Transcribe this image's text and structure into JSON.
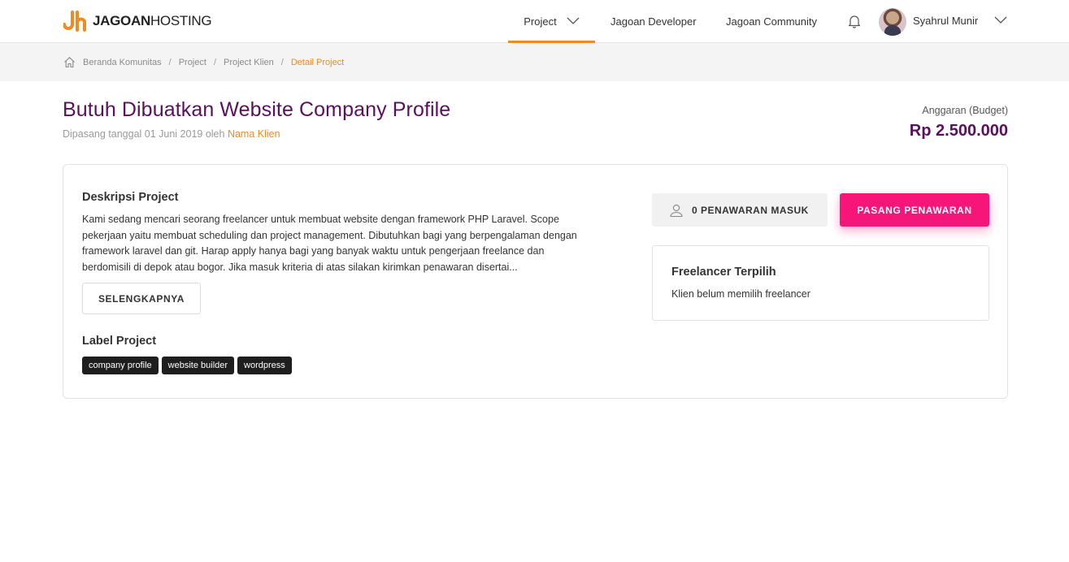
{
  "brand": {
    "name_bold": "JAGOAN",
    "name_light": "HOSTING",
    "accent": "#f08a24",
    "primary": "#5b0f5e",
    "cta": "#f7157a"
  },
  "nav": {
    "project": "Project",
    "developer": "Jagoan Developer",
    "community": "Jagoan Community",
    "user_name": "Syahrul Munir"
  },
  "breadcrumb": {
    "items": [
      "Beranda Komunitas",
      "Project",
      "Project Klien"
    ],
    "active": "Detail Project",
    "separator": "/"
  },
  "project": {
    "title": "Butuh Dibuatkan Website Company Profile",
    "posted_prefix": "Dipasang tanggal 01 Juni 2019 oleh",
    "client_name": "Nama Klien",
    "budget_label": "Anggaran (Budget)",
    "budget_value": "Rp 2.500.000"
  },
  "description": {
    "heading": "Deskripsi Project",
    "text": "Kami sedang mencari seorang freelancer untuk membuat website dengan framework PHP Laravel. Scope pekerjaan yaitu membuat scheduling dan project management. Dibutuhkan bagi yang berpengalaman dengan framework laravel dan git. Harap apply hanya bagi yang banyak waktu untuk pengerjaan freelance dan berdomisili di depok atau bogor. Jika masuk kriteria di atas silakan kirimkan penawaran disertai...",
    "more_button": "SELENGKAPNYA"
  },
  "labels": {
    "heading": "Label Project",
    "tags": [
      "company profile",
      "website builder",
      "wordpress"
    ]
  },
  "actions": {
    "offers_count": "0 PENAWARAN MASUK",
    "bid_button": "PASANG PENAWARAN"
  },
  "freelancer": {
    "heading": "Freelancer Terpilih",
    "status": "Klien belum memilih freelancer"
  },
  "icons": {
    "home": "home-icon",
    "bell": "bell-icon",
    "chevron": "chevron-down-icon",
    "user": "user-icon"
  }
}
